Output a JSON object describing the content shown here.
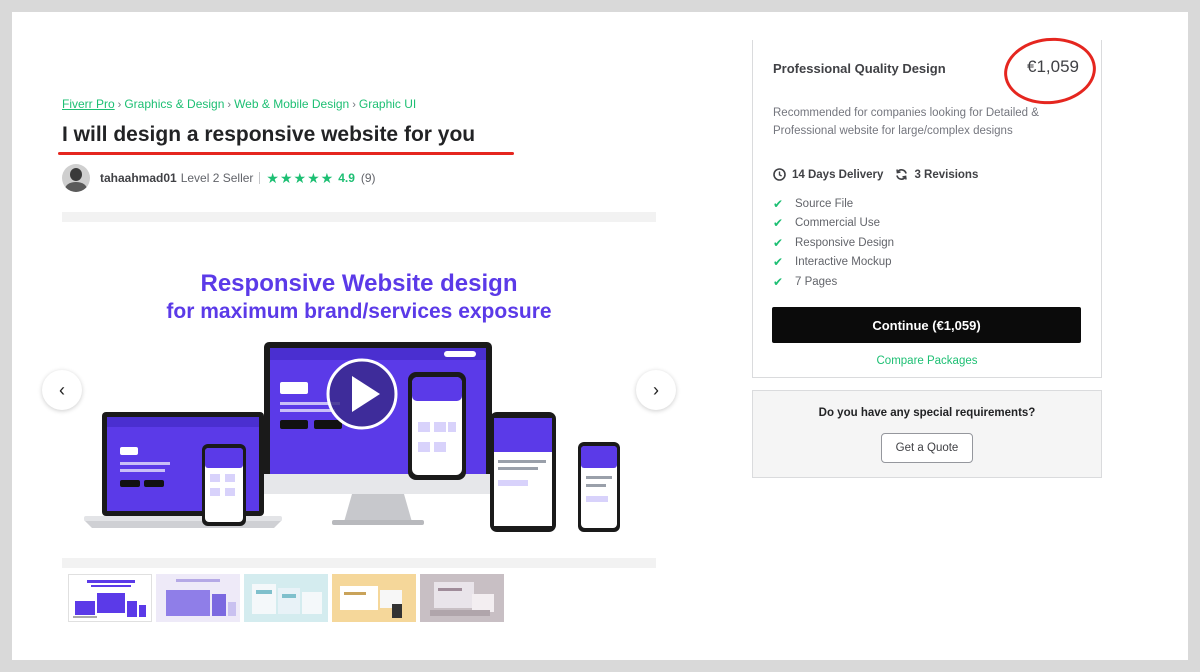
{
  "breadcrumb": {
    "items": [
      "Fiverr Pro",
      "Graphics & Design",
      "Web & Mobile Design",
      "Graphic UI"
    ],
    "separator": "›"
  },
  "gig": {
    "title": "I will design a responsive website for you"
  },
  "seller": {
    "name": "tahaahmad01",
    "level": "Level 2 Seller",
    "stars": "★★★★★",
    "rating": "4.9",
    "review_count": "(9)"
  },
  "gallery": {
    "headline": "Responsive Website design",
    "subheadline": "for maximum brand/services exposure",
    "prev_icon": "‹",
    "next_icon": "›",
    "thumbnail_count": 5,
    "colors": {
      "brand_purple": "#5b3ae8",
      "accent_green": "#1dbf73"
    }
  },
  "package": {
    "name": "Professional Quality Design",
    "price": "€1,059",
    "description": "Recommended for companies looking for Detailed & Professional website for large/complex designs",
    "delivery": "14 Days Delivery",
    "revisions": "3 Revisions",
    "features": [
      "Source File",
      "Commercial Use",
      "Responsive Design",
      "Interactive Mockup",
      "7 Pages"
    ],
    "continue_label": "Continue (€1,059)",
    "compare_label": "Compare Packages"
  },
  "quote": {
    "question": "Do you have any special requirements?",
    "button_label": "Get a Quote"
  },
  "annotations": {
    "highlight_color": "#e5261f"
  }
}
